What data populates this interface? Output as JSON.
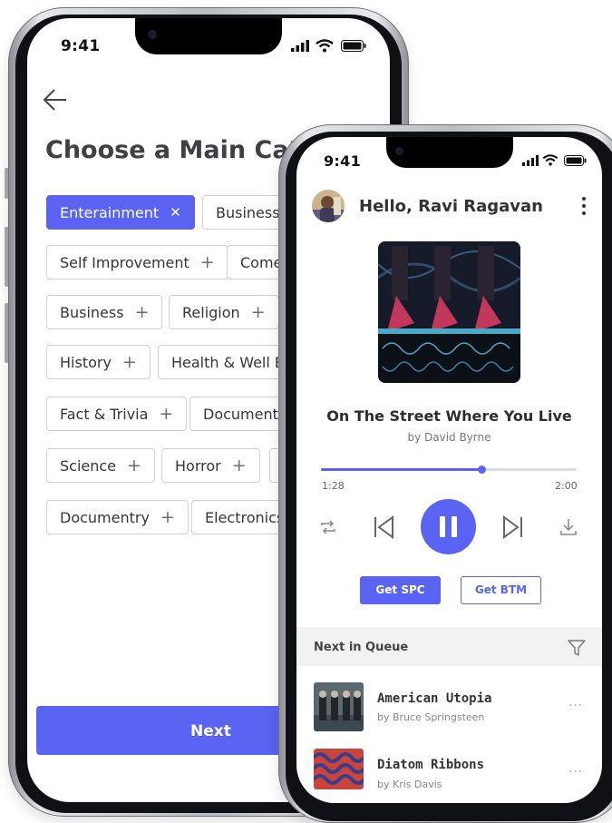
{
  "left_phone": {
    "status_time": "9:41",
    "title": "Choose a Main Categ",
    "chips": [
      {
        "label": "Enterainment",
        "selected": true
      },
      {
        "label": "Business"
      },
      {
        "label": "Self Improvement"
      },
      {
        "label": "Come"
      },
      {
        "label": "Business"
      },
      {
        "label": "Religion"
      },
      {
        "label": "History"
      },
      {
        "label": "Health & Well Be"
      },
      {
        "label": "Fact & Trivia"
      },
      {
        "label": "Documentr"
      },
      {
        "label": "Science"
      },
      {
        "label": "Horror"
      },
      {
        "label": "Documentry"
      },
      {
        "label": "Electronics"
      }
    ],
    "next_label": "Next"
  },
  "right_phone": {
    "status_time": "9:41",
    "greeting": "Hello, Ravi Ragavan",
    "song": {
      "title": "On The Street Where You Live",
      "artist": "by David Byrne"
    },
    "progress": {
      "elapsed": "1:28",
      "total": "2:00",
      "fraction": 0.63
    },
    "buttons": {
      "spc": "Get SPC",
      "btm": "Get BTM"
    },
    "queue": {
      "label": "Next in Queue",
      "items": [
        {
          "title": "American Utopia",
          "artist": "by Bruce Springsteen"
        },
        {
          "title": "Diatom Ribbons",
          "artist": "by Kris Davis"
        }
      ]
    },
    "more_glyph": "···",
    "colors": {
      "accent": "#5a63f2"
    }
  }
}
